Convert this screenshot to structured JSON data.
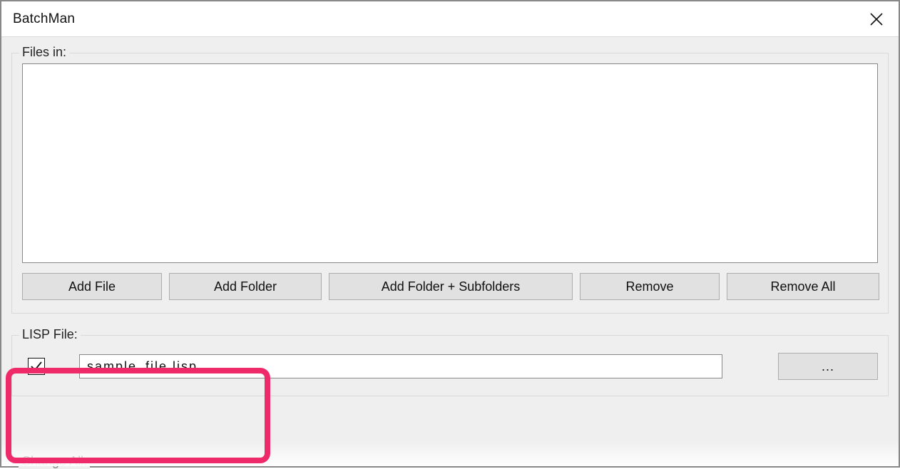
{
  "window": {
    "title": "BatchMan"
  },
  "filesGroup": {
    "label": "Files in:",
    "buttons": {
      "addFile": "Add File",
      "addFolder": "Add Folder",
      "addFolderSub": "Add Folder + Subfolders",
      "remove": "Remove",
      "removeAll": "Remove All"
    }
  },
  "lispGroup": {
    "label": "LISP File:",
    "checked": true,
    "value": "sample_file.lisp",
    "browse": "..."
  },
  "changeAll": {
    "label": "Change All:"
  }
}
